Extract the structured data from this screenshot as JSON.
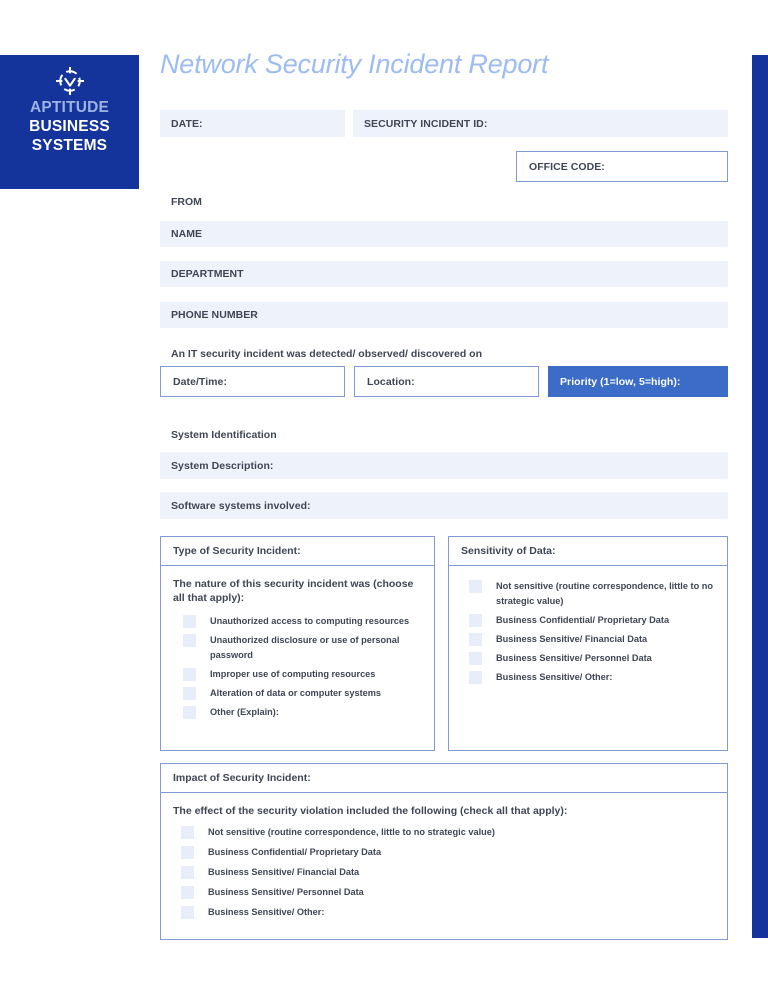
{
  "brand": {
    "logo_icon": "crosshair-target-icon",
    "line1": "APTITUDE",
    "line2": "BUSINESS",
    "line3": "SYSTEMS",
    "color": "#14349b"
  },
  "document": {
    "title": "Network Security Incident Report",
    "title_color": "#9cbcf2",
    "accent_color": "#14349b",
    "priority_box_color": "#3a6cc8",
    "field_fill_color": "#eef2fb",
    "border_color": "#7f9ad6",
    "checkbox_color": "#e8edfa"
  },
  "header_fields": {
    "date": "DATE:",
    "incident_id": "SECURITY INCIDENT ID:",
    "office_code": "OFFICE CODE:"
  },
  "from_section": {
    "heading": "FROM",
    "name": "NAME",
    "department": "DEPARTMENT",
    "phone": "PHONE NUMBER"
  },
  "detection": {
    "note": "An IT security incident was detected/ observed/ discovered on",
    "date_time": "Date/Time:",
    "location": "Location:",
    "priority": "Priority (1=low, 5=high):"
  },
  "system_identification": {
    "heading": "System Identification",
    "description": "System Description:",
    "software": "Software systems involved:"
  },
  "type_panel": {
    "heading": "Type of Security Incident:",
    "intro": "The nature of this security incident was (choose all that apply):",
    "options": [
      "Unauthorized access to computing resources",
      "Unauthorized disclosure or use of personal password",
      "Improper use of computing resources",
      "Alteration of data or computer systems",
      "Other (Explain):"
    ]
  },
  "sensitivity_panel": {
    "heading": "Sensitivity of Data:",
    "options": [
      "Not sensitive (routine correspondence, little to no strategic value)",
      "Business Confidential/ Proprietary Data",
      "Business Sensitive/ Financial Data",
      "Business Sensitive/ Personnel Data",
      "Business Sensitive/ Other:"
    ]
  },
  "impact_panel": {
    "heading": "Impact of Security Incident:",
    "intro": "The effect of the security violation included the following (check all that apply):",
    "options": [
      "Not sensitive (routine correspondence, little to no strategic value)",
      "Business Confidential/ Proprietary Data",
      "Business Sensitive/ Financial Data",
      "Business Sensitive/ Personnel Data",
      "Business Sensitive/ Other:"
    ]
  }
}
